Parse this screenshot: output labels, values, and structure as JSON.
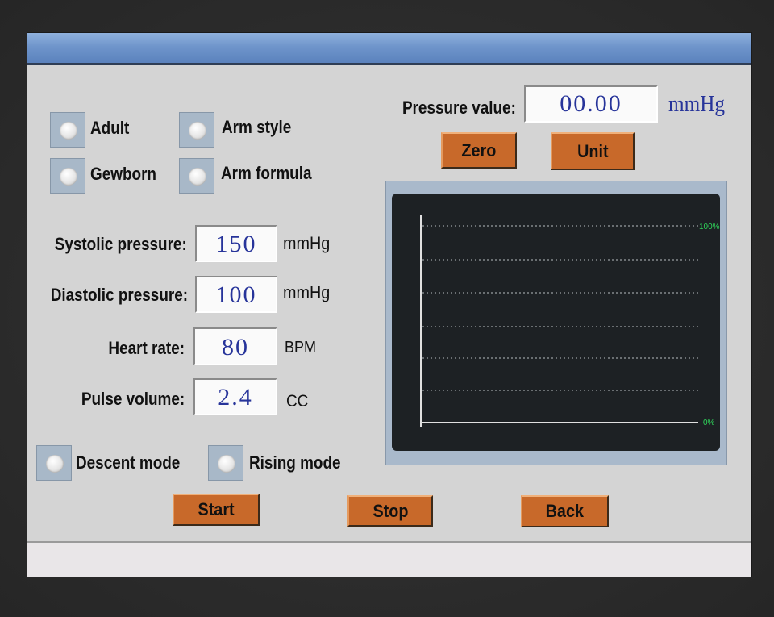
{
  "pressure": {
    "label": "Pressure value:",
    "value": "00.00",
    "unit": "mmHg"
  },
  "buttons": {
    "zero": "Zero",
    "unit": "Unit",
    "start": "Start",
    "stop": "Stop",
    "back": "Back"
  },
  "radios": {
    "adult": "Adult",
    "gewborn": "Gewborn",
    "arm_style": "Arm style",
    "arm_formula": "Arm formula",
    "descent_mode": "Descent mode",
    "rising_mode": "Rising mode"
  },
  "fields": {
    "systolic": {
      "label": "Systolic pressure:",
      "value": "150",
      "unit": "mmHg"
    },
    "diastolic": {
      "label": "Diastolic pressure:",
      "value": "100",
      "unit": "mmHg"
    },
    "heart_rate": {
      "label": "Heart rate:",
      "value": "80",
      "unit": "BPM"
    },
    "pulse_volume": {
      "label": "Pulse volume:",
      "value": "2.4",
      "unit": "CC"
    }
  },
  "graph": {
    "max_label": "100%",
    "min_label": "0%",
    "line_color": "#2fd45a"
  },
  "colors": {
    "button": "#c8692a",
    "field_text": "#27349a",
    "title_bar": "#6f95cb"
  }
}
